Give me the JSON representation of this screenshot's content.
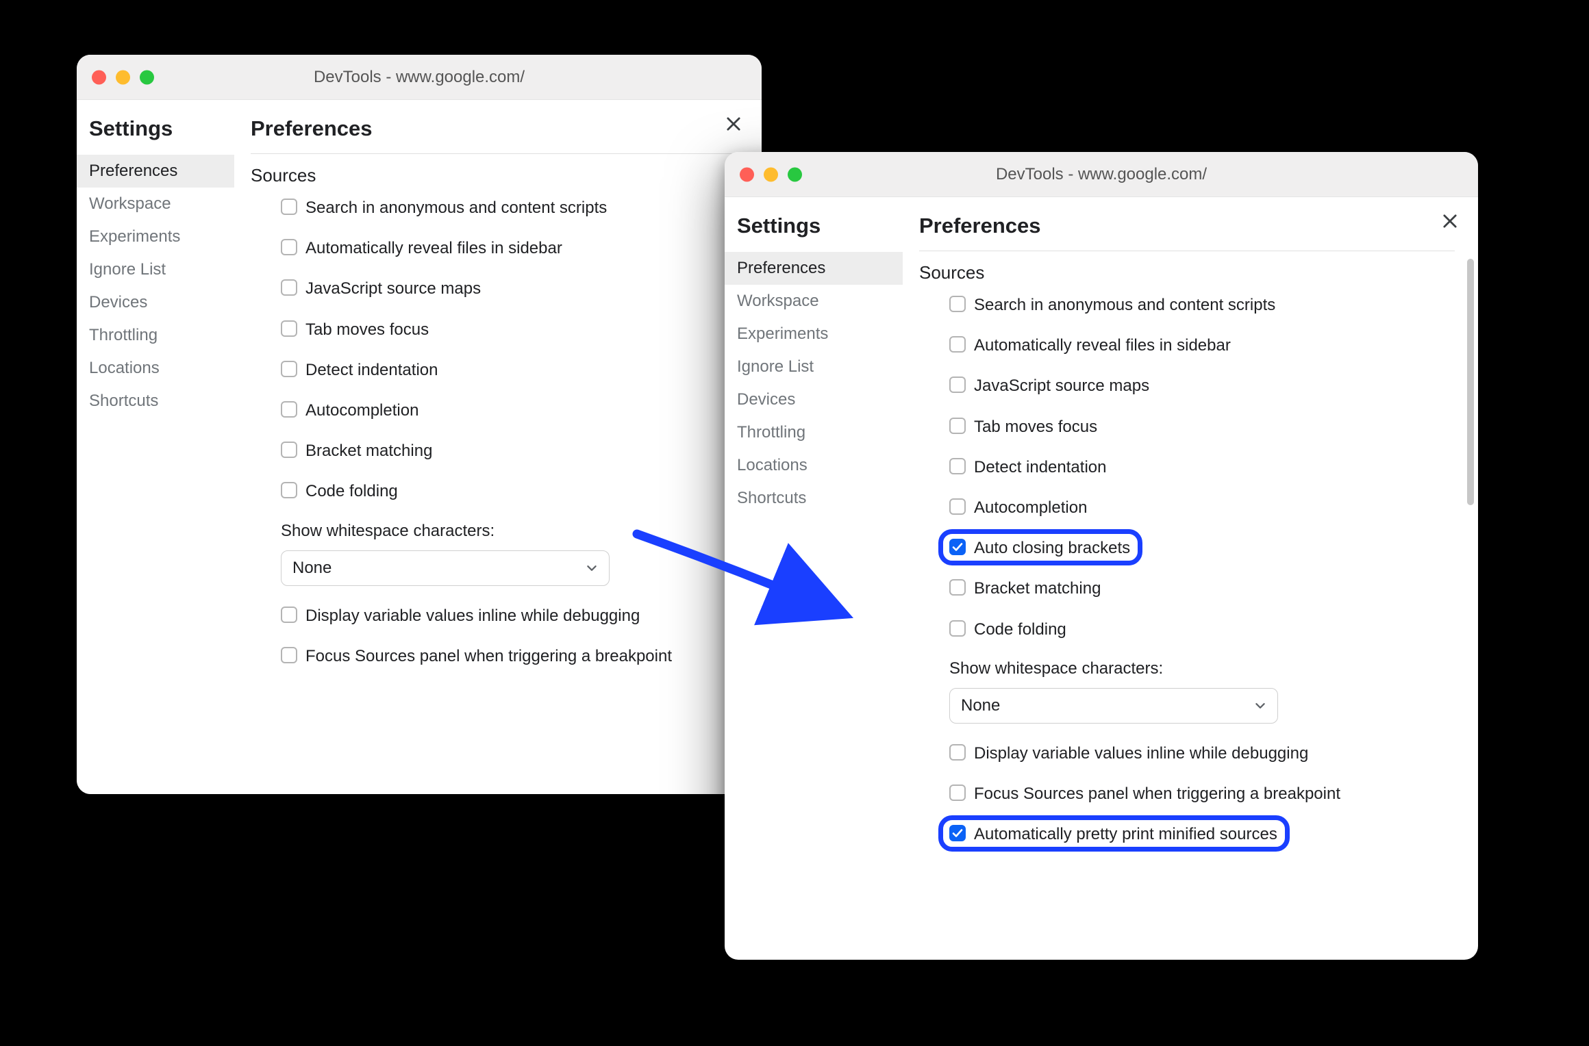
{
  "colors": {
    "highlight": "#1a3fff",
    "checkbox_checked": "#0b62f6"
  },
  "window_left": {
    "title": "DevTools - www.google.com/",
    "settings_heading": "Settings",
    "preferences_heading": "Preferences",
    "sidebar": [
      "Preferences",
      "Workspace",
      "Experiments",
      "Ignore List",
      "Devices",
      "Throttling",
      "Locations",
      "Shortcuts"
    ],
    "section_title": "Sources",
    "options": [
      {
        "label": "Search in anonymous and content scripts",
        "checked": false
      },
      {
        "label": "Automatically reveal files in sidebar",
        "checked": false
      },
      {
        "label": "JavaScript source maps",
        "checked": false
      },
      {
        "label": "Tab moves focus",
        "checked": false
      },
      {
        "label": "Detect indentation",
        "checked": false
      },
      {
        "label": "Autocompletion",
        "checked": false
      },
      {
        "label": "Bracket matching",
        "checked": false
      },
      {
        "label": "Code folding",
        "checked": false
      }
    ],
    "whitespace_label": "Show whitespace characters:",
    "whitespace_value": "None",
    "options_after": [
      {
        "label": "Display variable values inline while debugging",
        "checked": false
      },
      {
        "label": "Focus Sources panel when triggering a breakpoint",
        "checked": false
      }
    ]
  },
  "window_right": {
    "title": "DevTools - www.google.com/",
    "settings_heading": "Settings",
    "preferences_heading": "Preferences",
    "sidebar": [
      "Preferences",
      "Workspace",
      "Experiments",
      "Ignore List",
      "Devices",
      "Throttling",
      "Locations",
      "Shortcuts"
    ],
    "section_title": "Sources",
    "options": [
      {
        "label": "Search in anonymous and content scripts",
        "checked": false
      },
      {
        "label": "Automatically reveal files in sidebar",
        "checked": false
      },
      {
        "label": "JavaScript source maps",
        "checked": false
      },
      {
        "label": "Tab moves focus",
        "checked": false
      },
      {
        "label": "Detect indentation",
        "checked": false
      },
      {
        "label": "Autocompletion",
        "checked": false
      },
      {
        "label": "Auto closing brackets",
        "checked": true,
        "highlighted": true
      },
      {
        "label": "Bracket matching",
        "checked": false
      },
      {
        "label": "Code folding",
        "checked": false
      }
    ],
    "whitespace_label": "Show whitespace characters:",
    "whitespace_value": "None",
    "options_after": [
      {
        "label": "Display variable values inline while debugging",
        "checked": false
      },
      {
        "label": "Focus Sources panel when triggering a breakpoint",
        "checked": false
      },
      {
        "label": "Automatically pretty print minified sources",
        "checked": true,
        "highlighted": true
      }
    ]
  }
}
